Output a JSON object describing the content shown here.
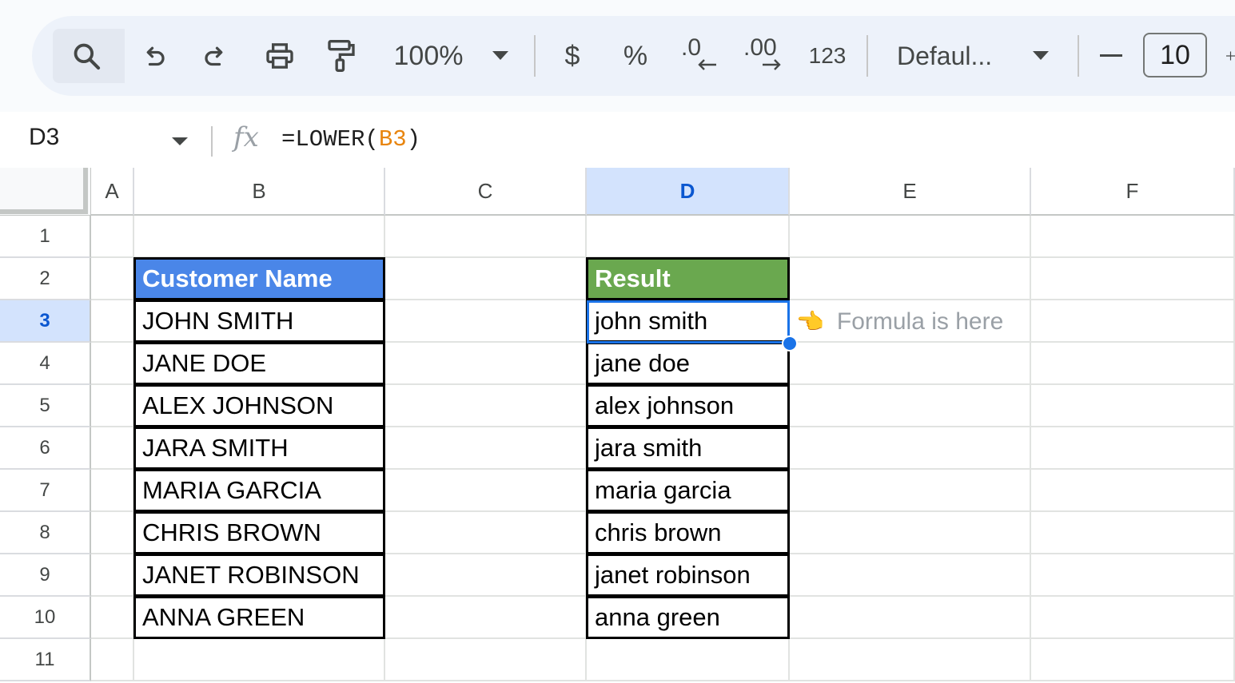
{
  "toolbar": {
    "zoom": "100%",
    "currency": "$",
    "percent": "%",
    "decrease_decimal": ".0",
    "increase_decimal": ".00",
    "number_format": "123",
    "font_family": "Defaul...",
    "font_size_minus": "–",
    "font_size": "10",
    "icons": [
      "search-icon",
      "undo-icon",
      "redo-icon",
      "print-icon",
      "paint-format-icon",
      "zoom-dropdown-icon",
      "font-dropdown-icon"
    ]
  },
  "formula_bar": {
    "cell_ref": "D3",
    "fx": "fx",
    "formula_prefix": "=LOWER(",
    "formula_ref": "B3",
    "formula_suffix": ")"
  },
  "columns": [
    "A",
    "B",
    "C",
    "D",
    "E",
    "F"
  ],
  "selected_column": "D",
  "rows": [
    "1",
    "2",
    "3",
    "4",
    "5",
    "6",
    "7",
    "8",
    "9",
    "10",
    "11"
  ],
  "selected_row": "3",
  "table_b": {
    "header": "Customer Name",
    "values": [
      "JOHN SMITH",
      "JANE DOE",
      "ALEX JOHNSON",
      "JARA SMITH",
      "MARIA GARCIA",
      "CHRIS BROWN",
      "JANET ROBINSON",
      "ANNA GREEN"
    ]
  },
  "table_d": {
    "header": "Result",
    "values": [
      "john smith",
      "jane doe",
      "alex johnson",
      "jara smith",
      "maria garcia",
      "chris brown",
      "janet robinson",
      "anna green"
    ]
  },
  "annotation": {
    "hand": "👈",
    "text": "Formula is here"
  },
  "colors": {
    "header_blue": "#4a86e8",
    "header_green": "#6aa84f",
    "selection": "#1a73e8"
  }
}
